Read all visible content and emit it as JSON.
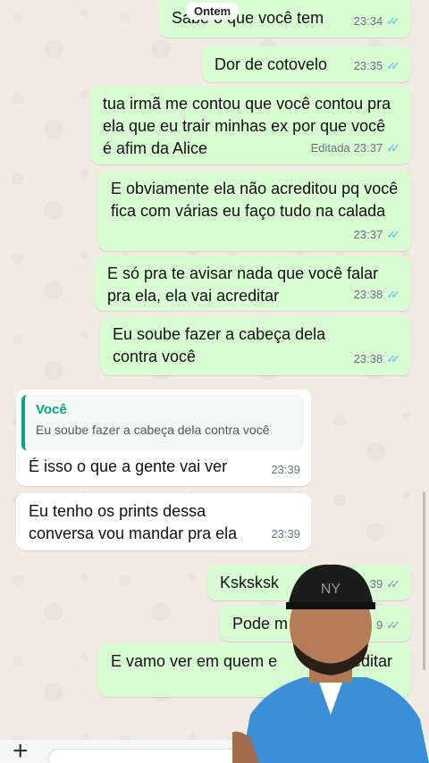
{
  "date_divider": "Ontem",
  "messages": [
    {
      "text": "Sabe o que você tem",
      "time": "23:34"
    },
    {
      "text": "Dor de cotovelo",
      "time": "23:35"
    },
    {
      "text": "tua irmã me contou que você contou pra ela que eu trair minhas ex por que você é afim da Alice",
      "time": "23:37",
      "edited": "Editada"
    },
    {
      "text": "E obviamente ela não acreditou pq você fica com várias eu faço tudo na calada",
      "time": "23:37"
    },
    {
      "text": "E só pra te avisar nada que você falar pra ela, ela vai acreditar",
      "time": "23:38"
    },
    {
      "text": "Eu soube fazer a cabeça dela contra você",
      "time": "23:38"
    },
    {
      "quote_author": "Você",
      "quote_text": "Eu soube fazer a cabeça dela contra você",
      "text": "É isso o que a gente vai ver",
      "time": "23:39"
    },
    {
      "text": "Eu tenho os prints dessa conversa vou mandar pra ela",
      "time": "23:39"
    },
    {
      "text": "Ksksksk",
      "time": "39"
    },
    {
      "text": "Pode m",
      "time": "9"
    },
    {
      "text": "E vamo ver em quem e",
      "text_tail": "editar"
    }
  ],
  "overlay": {
    "cap_label": "NY"
  },
  "colors": {
    "outgoing": "#d9fdd3",
    "incoming": "#ffffff",
    "quote_accent": "#06a884",
    "read_ticks": "#53bdeb"
  }
}
